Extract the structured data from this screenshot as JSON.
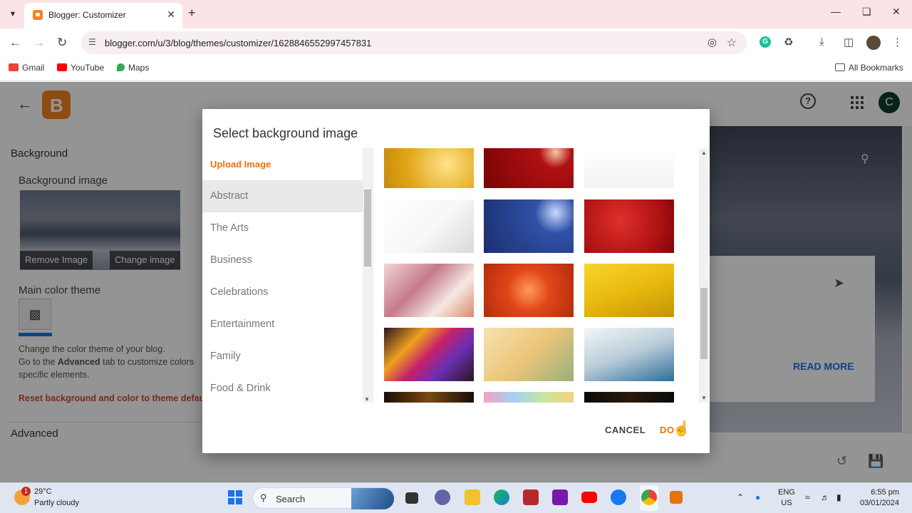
{
  "browser": {
    "tab_title": "Blogger: Customizer",
    "url": "blogger.com/u/3/blog/themes/customizer/1628846552997457831",
    "bookmarks": [
      {
        "label": "Gmail",
        "color": "#ea4335"
      },
      {
        "label": "YouTube",
        "color": "#ff0000"
      },
      {
        "label": "Maps",
        "color": "#34a853"
      }
    ],
    "all_bookmarks": "All Bookmarks"
  },
  "customizer": {
    "background_heading": "Background",
    "background_image_label": "Background image",
    "remove_image": "Remove Image",
    "change_image": "Change image",
    "main_color_label": "Main color theme",
    "desc_line1": "Change the color theme of your blog.",
    "desc_line2_a": "Go to the ",
    "desc_line2_b": "Advanced",
    "desc_line2_c": " tab to customize colors",
    "desc_line3": "specific elements.",
    "reset_link": "Reset background and color to theme defau",
    "advanced_heading": "Advanced",
    "avatar_letter": "C",
    "read_more": "READ MORE"
  },
  "dialog": {
    "title": "Select background image",
    "upload": "Upload Image",
    "categories": [
      "Abstract",
      "The Arts",
      "Business",
      "Celebrations",
      "Entertainment",
      "Family",
      "Food & Drink"
    ],
    "selected_category": "Abstract",
    "cancel": "CANCEL",
    "done": "DO"
  },
  "taskbar": {
    "temp": "29°C",
    "weather": "Partly cloudy",
    "weather_badge": "1",
    "search": "Search",
    "lang1": "ENG",
    "lang2": "US",
    "time": "6:55 pm",
    "date": "03/01/2024"
  }
}
